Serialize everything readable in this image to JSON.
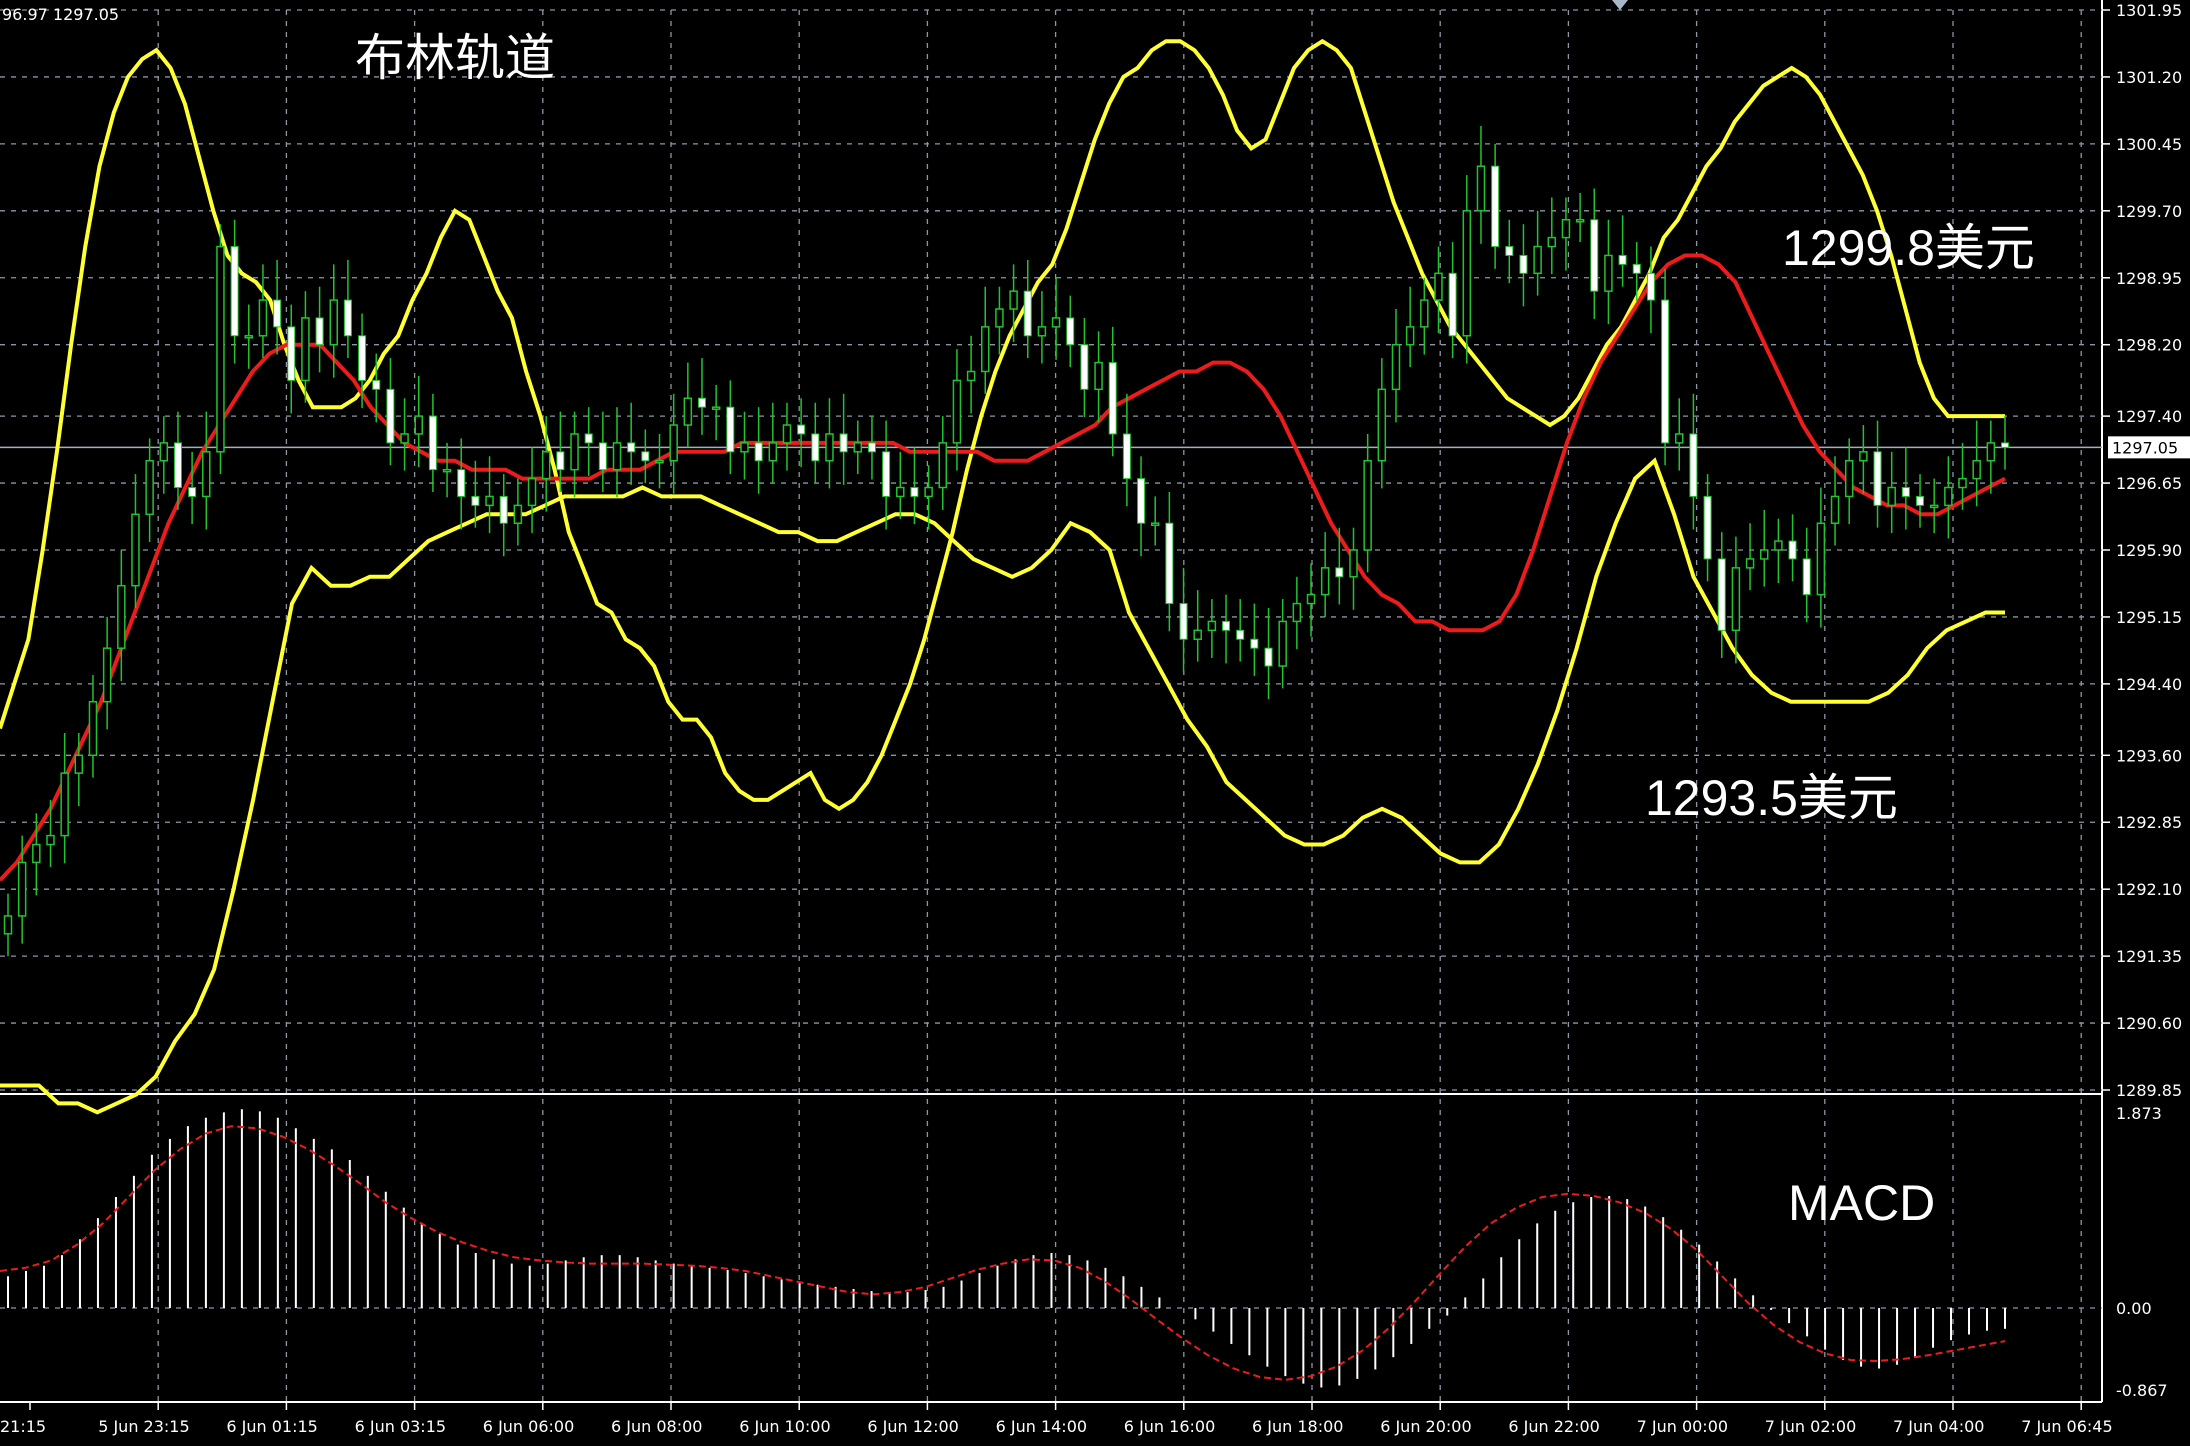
{
  "header": {
    "ohlc_text": "96.97 1297.05"
  },
  "colors": {
    "background": "#000000",
    "grid": "#8c97a6",
    "bull_candle": "#ffffff",
    "wick": "#22c32e",
    "bollinger": "#ffff33",
    "midline": "#ee1b1b",
    "macd_hist": "#ffffff",
    "macd_signal": "#ee1b1b",
    "text": "#ffffff"
  },
  "annotations": {
    "title": "布林轨道",
    "upper_price": "1299.8美元",
    "lower_price": "1293.5美元",
    "macd_label": "MACD"
  },
  "chart_data": {
    "type": "candlestick",
    "title": "布林轨道",
    "ylim": [
      1289.85,
      1301.95
    ],
    "y_ticks": [
      "1301.95",
      "1301.20",
      "1300.45",
      "1299.70",
      "1298.95",
      "1298.20",
      "1297.40",
      "1296.65",
      "1295.90",
      "1295.15",
      "1294.40",
      "1293.60",
      "1292.85",
      "1292.10",
      "1291.35",
      "1290.60",
      "1289.85"
    ],
    "current_price": "1297.05",
    "x_labels": [
      "21:15",
      "5 Jun 23:15",
      "6 Jun 01:15",
      "6 Jun 03:15",
      "6 Jun 06:00",
      "6 Jun 08:00",
      "6 Jun 10:00",
      "6 Jun 12:00",
      "6 Jun 14:00",
      "6 Jun 16:00",
      "6 Jun 18:00",
      "6 Jun 20:00",
      "6 Jun 22:00",
      "7 Jun 00:00",
      "7 Jun 02:00",
      "7 Jun 04:00",
      "7 Jun 06:45"
    ],
    "grid": true,
    "closes": [
      1291.8,
      1292.4,
      1292.6,
      1292.7,
      1293.4,
      1293.6,
      1294.2,
      1294.8,
      1295.5,
      1296.3,
      1296.9,
      1297.1,
      1296.6,
      1296.5,
      1297.0,
      1299.3,
      1298.3,
      1298.3,
      1298.7,
      1298.4,
      1297.8,
      1298.5,
      1298.2,
      1298.7,
      1298.3,
      1297.8,
      1297.7,
      1297.1,
      1297.2,
      1297.4,
      1296.8,
      1296.8,
      1296.5,
      1296.4,
      1296.5,
      1296.2,
      1296.4,
      1296.7,
      1297.0,
      1296.8,
      1297.2,
      1297.1,
      1296.8,
      1297.1,
      1297.0,
      1296.9,
      1296.9,
      1297.3,
      1297.6,
      1297.5,
      1297.5,
      1297.0,
      1297.1,
      1296.9,
      1297.1,
      1297.3,
      1297.2,
      1296.9,
      1297.2,
      1297.0,
      1297.1,
      1297.0,
      1296.5,
      1296.6,
      1296.5,
      1296.6,
      1297.1,
      1297.8,
      1297.9,
      1298.4,
      1298.6,
      1298.8,
      1298.3,
      1298.4,
      1298.5,
      1298.2,
      1297.7,
      1298.0,
      1297.2,
      1296.7,
      1296.2,
      1296.2,
      1295.3,
      1294.9,
      1295.0,
      1295.1,
      1295.0,
      1294.9,
      1294.8,
      1294.6,
      1295.1,
      1295.3,
      1295.4,
      1295.7,
      1295.6,
      1295.9,
      1296.9,
      1297.7,
      1298.2,
      1298.4,
      1298.7,
      1299.0,
      1298.3,
      1299.7,
      1300.2,
      1299.3,
      1299.2,
      1299.0,
      1299.3,
      1299.4,
      1299.6,
      1299.6,
      1298.8,
      1299.2,
      1299.1,
      1299.0,
      1298.7,
      1297.1,
      1297.2,
      1296.5,
      1295.8,
      1295.0,
      1295.7,
      1295.8,
      1295.9,
      1296.0,
      1295.8,
      1295.4,
      1296.2,
      1296.5,
      1296.9,
      1297.0,
      1296.4,
      1296.6,
      1296.5,
      1296.4,
      1296.4,
      1296.6,
      1296.7,
      1296.9,
      1297.1,
      1297.05
    ],
    "upper_band": [
      1293.9,
      1294.4,
      1294.9,
      1295.9,
      1297.0,
      1298.2,
      1299.3,
      1300.2,
      1300.8,
      1301.2,
      1301.4,
      1301.5,
      1301.3,
      1300.9,
      1300.3,
      1299.7,
      1299.2,
      1299.0,
      1298.9,
      1298.7,
      1298.2,
      1297.8,
      1297.5,
      1297.5,
      1297.5,
      1297.6,
      1297.8,
      1298.1,
      1298.3,
      1298.7,
      1299.0,
      1299.4,
      1299.7,
      1299.6,
      1299.2,
      1298.8,
      1298.5,
      1297.9,
      1297.4,
      1296.8,
      1296.1,
      1295.7,
      1295.3,
      1295.2,
      1294.9,
      1294.8,
      1294.6,
      1294.2,
      1294.0,
      1294.0,
      1293.8,
      1293.4,
      1293.2,
      1293.1,
      1293.1,
      1293.2,
      1293.3,
      1293.4,
      1293.1,
      1293.0,
      1293.1,
      1293.3,
      1293.6,
      1294.0,
      1294.4,
      1294.9,
      1295.5,
      1296.1,
      1296.8,
      1297.4,
      1297.9,
      1298.3,
      1298.6,
      1298.9,
      1299.1,
      1299.5,
      1300.0,
      1300.5,
      1300.9,
      1301.2,
      1301.3,
      1301.5,
      1301.6,
      1301.6,
      1301.5,
      1301.3,
      1301.0,
      1300.6,
      1300.4,
      1300.5,
      1300.9,
      1301.3,
      1301.5,
      1301.6,
      1301.5,
      1301.3,
      1300.8,
      1300.3,
      1299.8,
      1299.4,
      1299.0,
      1298.7,
      1298.4,
      1298.2,
      1298.0,
      1297.8,
      1297.6,
      1297.5,
      1297.4,
      1297.3,
      1297.4,
      1297.6,
      1297.9,
      1298.2,
      1298.4,
      1298.7,
      1299.0,
      1299.4,
      1299.6,
      1299.9,
      1300.2,
      1300.4,
      1300.7,
      1300.9,
      1301.1,
      1301.2,
      1301.3,
      1301.2,
      1301.0,
      1300.7,
      1300.4,
      1300.1,
      1299.7,
      1299.2,
      1298.6,
      1298.0,
      1297.6,
      1297.4,
      1297.4,
      1297.4,
      1297.4,
      1297.4
    ],
    "middle_band": [
      1292.2,
      1292.4,
      1292.7,
      1293.0,
      1293.4,
      1293.8,
      1294.2,
      1294.7,
      1295.2,
      1295.7,
      1296.2,
      1296.6,
      1297.0,
      1297.3,
      1297.6,
      1297.9,
      1298.1,
      1298.2,
      1298.2,
      1298.2,
      1298.0,
      1297.8,
      1297.5,
      1297.3,
      1297.1,
      1297.0,
      1296.9,
      1296.9,
      1296.8,
      1296.8,
      1296.8,
      1296.7,
      1296.7,
      1296.7,
      1296.7,
      1296.7,
      1296.8,
      1296.8,
      1296.8,
      1296.9,
      1297.0,
      1297.0,
      1297.0,
      1297.0,
      1297.1,
      1297.1,
      1297.1,
      1297.1,
      1297.1,
      1297.1,
      1297.1,
      1297.1,
      1297.1,
      1297.1,
      1297.0,
      1297.0,
      1297.0,
      1297.0,
      1297.0,
      1296.9,
      1296.9,
      1296.9,
      1297.0,
      1297.1,
      1297.2,
      1297.3,
      1297.5,
      1297.6,
      1297.7,
      1297.8,
      1297.9,
      1297.9,
      1298.0,
      1298.0,
      1297.9,
      1297.7,
      1297.4,
      1297.0,
      1296.6,
      1296.2,
      1295.9,
      1295.6,
      1295.4,
      1295.3,
      1295.1,
      1295.1,
      1295.0,
      1295.0,
      1295.0,
      1295.1,
      1295.4,
      1295.9,
      1296.5,
      1297.1,
      1297.6,
      1298.0,
      1298.3,
      1298.6,
      1298.9,
      1299.1,
      1299.2,
      1299.2,
      1299.1,
      1298.9,
      1298.5,
      1298.1,
      1297.7,
      1297.3,
      1297.0,
      1296.8,
      1296.6,
      1296.5,
      1296.4,
      1296.4,
      1296.3,
      1296.3,
      1296.4,
      1296.5,
      1296.6,
      1296.7
    ],
    "lower_band": [
      1289.9,
      1289.9,
      1289.9,
      1289.7,
      1289.7,
      1289.6,
      1289.7,
      1289.8,
      1290.0,
      1290.4,
      1290.7,
      1291.2,
      1292.1,
      1293.1,
      1294.2,
      1295.3,
      1295.7,
      1295.5,
      1295.5,
      1295.6,
      1295.6,
      1295.8,
      1296.0,
      1296.1,
      1296.2,
      1296.3,
      1296.3,
      1296.3,
      1296.4,
      1296.5,
      1296.5,
      1296.5,
      1296.5,
      1296.6,
      1296.5,
      1296.5,
      1296.5,
      1296.4,
      1296.3,
      1296.2,
      1296.1,
      1296.1,
      1296.0,
      1296.0,
      1296.1,
      1296.2,
      1296.3,
      1296.3,
      1296.2,
      1296.0,
      1295.8,
      1295.7,
      1295.6,
      1295.7,
      1295.9,
      1296.2,
      1296.1,
      1295.9,
      1295.2,
      1294.8,
      1294.4,
      1294.0,
      1293.7,
      1293.3,
      1293.1,
      1292.9,
      1292.7,
      1292.6,
      1292.6,
      1292.7,
      1292.9,
      1293.0,
      1292.9,
      1292.7,
      1292.5,
      1292.4,
      1292.4,
      1292.6,
      1293.0,
      1293.5,
      1294.1,
      1294.8,
      1295.6,
      1296.2,
      1296.7,
      1296.9,
      1296.3,
      1295.6,
      1295.2,
      1294.8,
      1294.5,
      1294.3,
      1294.2,
      1294.2,
      1294.2,
      1294.2,
      1294.2,
      1294.3,
      1294.5,
      1294.8,
      1295.0,
      1295.1,
      1295.2,
      1295.2
    ]
  },
  "macd_data": {
    "ylim": [
      -0.867,
      1.873
    ],
    "y_ticks": [
      "1.873",
      "0.00",
      "-0.867"
    ],
    "histogram": [
      0.3,
      0.35,
      0.4,
      0.5,
      0.65,
      0.85,
      1.05,
      1.25,
      1.45,
      1.6,
      1.72,
      1.8,
      1.85,
      1.88,
      1.86,
      1.8,
      1.7,
      1.6,
      1.5,
      1.4,
      1.25,
      1.1,
      0.95,
      0.8,
      0.7,
      0.6,
      0.52,
      0.46,
      0.42,
      0.4,
      0.42,
      0.45,
      0.48,
      0.5,
      0.5,
      0.48,
      0.45,
      0.42,
      0.4,
      0.38,
      0.36,
      0.33,
      0.3,
      0.27,
      0.24,
      0.22,
      0.2,
      0.18,
      0.16,
      0.15,
      0.15,
      0.17,
      0.2,
      0.26,
      0.33,
      0.4,
      0.46,
      0.5,
      0.52,
      0.5,
      0.45,
      0.38,
      0.3,
      0.2,
      0.1,
      0.0,
      -0.12,
      -0.25,
      -0.38,
      -0.5,
      -0.62,
      -0.72,
      -0.8,
      -0.84,
      -0.82,
      -0.75,
      -0.65,
      -0.52,
      -0.38,
      -0.22,
      -0.08,
      0.1,
      0.28,
      0.48,
      0.65,
      0.8,
      0.92,
      1.0,
      1.05,
      1.06,
      1.03,
      0.96,
      0.86,
      0.74,
      0.6,
      0.44,
      0.28,
      0.12,
      -0.02,
      -0.16,
      -0.3,
      -0.44,
      -0.55,
      -0.62,
      -0.64,
      -0.6,
      -0.52,
      -0.42,
      -0.34,
      -0.28,
      -0.24,
      -0.22
    ],
    "signal": [
      0.35,
      0.38,
      0.45,
      0.6,
      0.8,
      1.05,
      1.3,
      1.5,
      1.65,
      1.72,
      1.7,
      1.62,
      1.5,
      1.35,
      1.18,
      1.0,
      0.85,
      0.72,
      0.62,
      0.54,
      0.48,
      0.45,
      0.43,
      0.42,
      0.42,
      0.42,
      0.41,
      0.4,
      0.38,
      0.35,
      0.3,
      0.25,
      0.2,
      0.15,
      0.13,
      0.15,
      0.2,
      0.28,
      0.36,
      0.42,
      0.46,
      0.45,
      0.38,
      0.25,
      0.08,
      -0.12,
      -0.32,
      -0.5,
      -0.64,
      -0.73,
      -0.76,
      -0.72,
      -0.62,
      -0.45,
      -0.22,
      0.05,
      0.32,
      0.58,
      0.8,
      0.95,
      1.05,
      1.08,
      1.06,
      1.0,
      0.9,
      0.75,
      0.55,
      0.3,
      0.05,
      -0.18,
      -0.36,
      -0.48,
      -0.55,
      -0.56,
      -0.54,
      -0.5,
      -0.45,
      -0.4,
      -0.35
    ]
  }
}
